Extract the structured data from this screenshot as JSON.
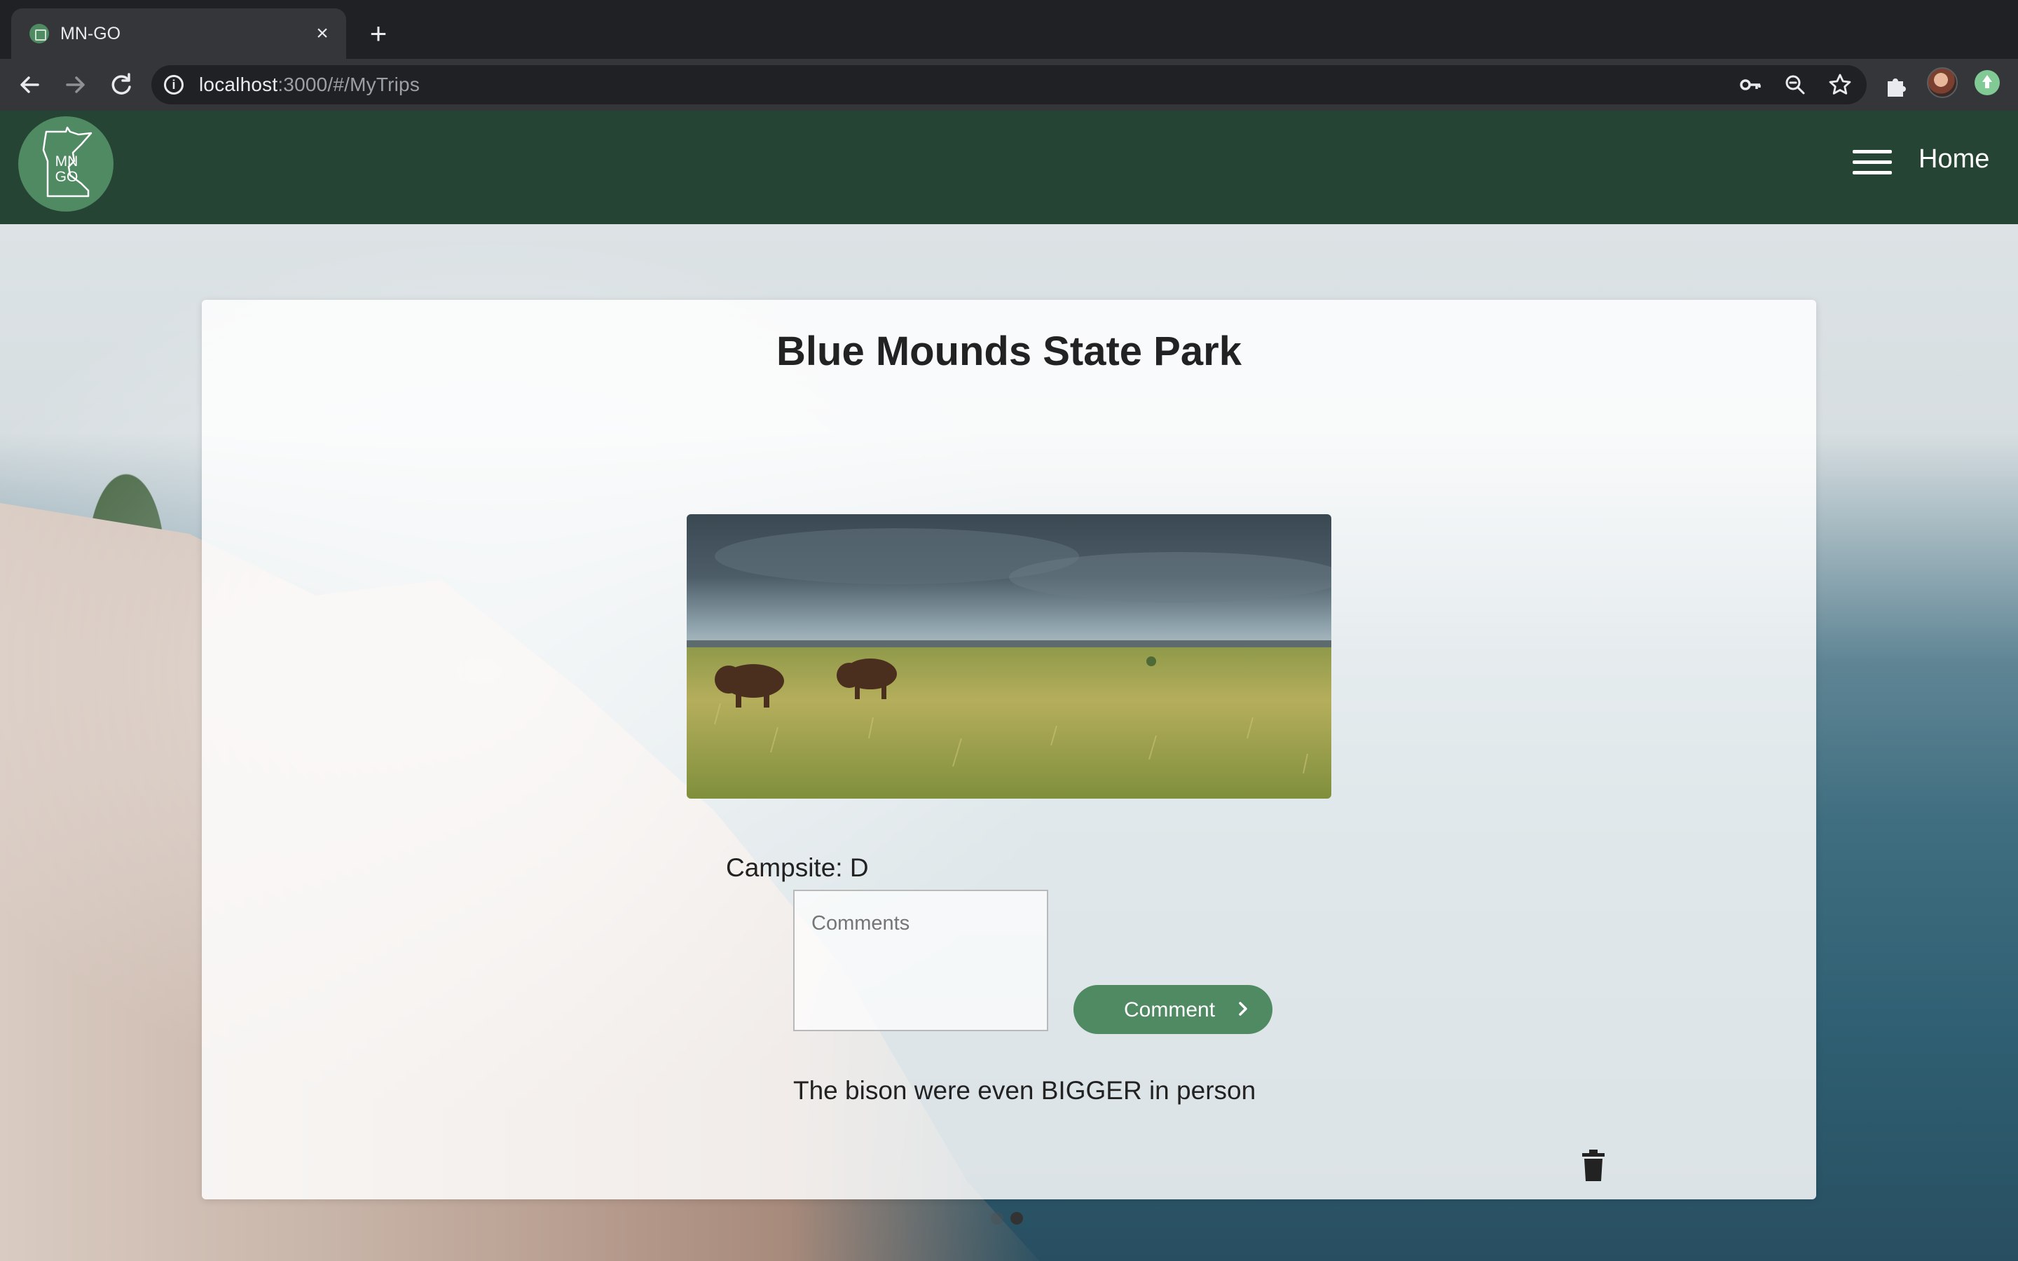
{
  "browser": {
    "tab_title": "MN-GO",
    "tab_close": "×",
    "new_tab": "+",
    "url_host": "localhost",
    "url_rest": ":3000/#/MyTrips"
  },
  "app": {
    "logo_text": "MN GO",
    "nav_home": "Home",
    "accent_color": "#4f8a62",
    "header_color": "#264433"
  },
  "trip": {
    "park_name": "Blue Mounds State Park",
    "photo_alt": "Bison on prairie",
    "campsite": "Campsite: D",
    "comments_placeholder": "Comments",
    "comment_button": "Comment",
    "comment_text": "The bison were even BIGGER in person"
  },
  "carousel": {
    "slide_count": 2,
    "active_slide": 2
  }
}
